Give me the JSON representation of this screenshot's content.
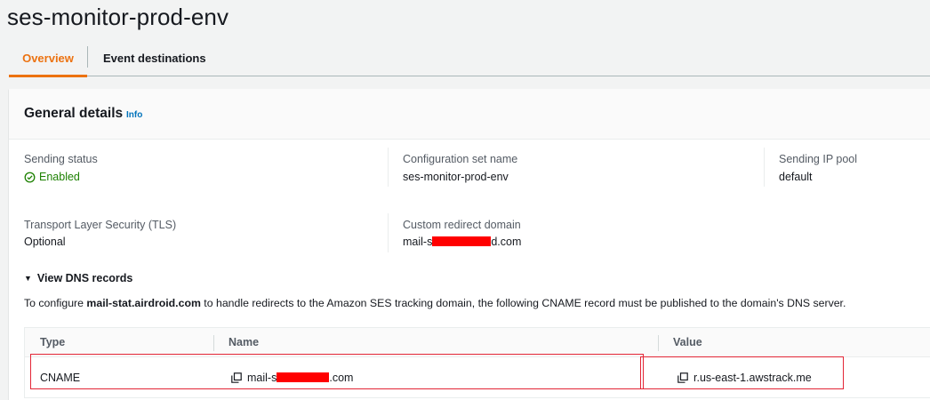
{
  "page_title": "ses-monitor-prod-env",
  "tabs": [
    {
      "label": "Overview",
      "active": true
    },
    {
      "label": "Event destinations",
      "active": false
    }
  ],
  "general_details": {
    "title": "General details",
    "info_label": "Info",
    "fields": {
      "sending_status": {
        "label": "Sending status",
        "value": "Enabled",
        "status_color": "#1d8102",
        "icon": "status-positive-icon"
      },
      "config_set_name": {
        "label": "Configuration set name",
        "value": "ses-monitor-prod-env"
      },
      "ip_pool": {
        "label": "Sending IP pool",
        "value": "default"
      },
      "tls": {
        "label": "Transport Layer Security (TLS)",
        "value": "Optional"
      },
      "redirect_domain": {
        "label": "Custom redirect domain",
        "value_prefix": "mail-s",
        "value_suffix": "d.com",
        "redacted": true
      }
    }
  },
  "dns": {
    "toggle_label": "View DNS records",
    "desc_prefix": "To configure ",
    "desc_domain": "mail-stat.airdroid.com",
    "desc_suffix": " to handle redirects to the Amazon SES tracking domain, the following CNAME record must be published to the domain's DNS server.",
    "table": {
      "columns": [
        "Type",
        "Name",
        "Value"
      ],
      "rows": [
        {
          "type": "CNAME",
          "name_prefix": "mail-s",
          "name_suffix": ".com",
          "name_redacted": true,
          "value": "r.us-east-1.awstrack.me"
        }
      ]
    }
  },
  "colors": {
    "accent": "#ec7211",
    "link": "#0073bb",
    "success": "#1d8102",
    "redaction": "#ff0000",
    "highlight_box": "#e32636"
  }
}
